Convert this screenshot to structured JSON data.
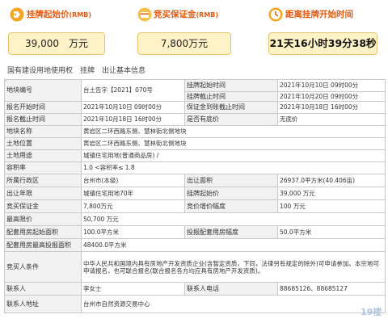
{
  "top": {
    "start_price": {
      "label": "挂牌起始价",
      "unit": "(RMB)",
      "value": "39,000　万元"
    },
    "deposit": {
      "label": "竞买保证金",
      "unit": "(RMB)",
      "value": "7,800万元"
    },
    "countdown": {
      "label": "距离挂牌开始时间",
      "value": "21天16小时39分38秒"
    }
  },
  "title": "国有建设用地使用权　挂牌　出让基本信息",
  "rows": {
    "r1": {
      "a": "地块编号",
      "b": "台土告字【2021】070号",
      "c": "挂牌起始时间",
      "d": "2021年10月10日 09时00分"
    },
    "r2": {
      "c": "挂牌截止时间",
      "d": "2021年10月20日 09时00分"
    },
    "r3": {
      "a": "报名开始时间",
      "b": "2021年10月10日 09时00分",
      "c": "保证金到账截止时间",
      "d": "2021年10月18日 16时00分"
    },
    "r4": {
      "a": "报名截止时间",
      "b": "2021年10月18日 16时00分",
      "c": "是否有底价",
      "d": "无底价"
    },
    "r5": {
      "a": "地块名称",
      "b": "黄岩区二环西路东侧、慧林街北侧地块"
    },
    "r6": {
      "a": "土地位置",
      "b": "黄岩区二环西路东侧、慧林街北侧地块"
    },
    "r7": {
      "a": "土地用途",
      "b": "城镇住宅用地(普通商品房) /"
    },
    "r8": {
      "a": "容积率",
      "b": "1.0 <容积率≤ 1.8"
    },
    "r9": {
      "a": "所属行政区",
      "b": "台州市(本级)",
      "c": "出让面积",
      "d": "26937.0平方米(40.406亩)"
    },
    "r10": {
      "a": "出让年限",
      "b": "城镇住宅用地70年",
      "c": "挂牌起始价",
      "d": "39,000 万元"
    },
    "r11": {
      "a": "竞买保证金",
      "b": "7,800万元",
      "c": "竞价增价幅度",
      "d": "100 万元"
    },
    "r12": {
      "a": "最高限价",
      "b": "50,700 万元"
    },
    "r13": {
      "a": "配套用房起始面积",
      "b": "100.0平方米",
      "c": "投报配套用房幅度",
      "d": "50.0平方米"
    },
    "r14": {
      "a": "配套用房最高投报面积",
      "b": "48400.0平方米"
    },
    "r15": {
      "a": "竞买人条件",
      "b": "中华人民共和国境内具有房地产开发资质企业(含暂定资质，下同，法律另有规定的除外)可申请参加。本宗地可申请报名，也可联合报名(联合报名各方均应具有房地产开发资质)。"
    },
    "r16": {
      "a": "联系人",
      "b": "李女士",
      "c": "联系人电话",
      "d": "88685126、88685127"
    },
    "r17": {
      "a": "联系人地址",
      "b": "台州市自然资源交易中心"
    }
  },
  "watermark": {
    "text": "19楼"
  },
  "colors": {
    "accent": "#e05a10",
    "highlight_bg": "#fff2c6",
    "label_bg": "#f1f1f1",
    "border": "#c9c9c9"
  },
  "icons": [
    "price-tag-icon",
    "deposit-icon",
    "clock-icon"
  ]
}
